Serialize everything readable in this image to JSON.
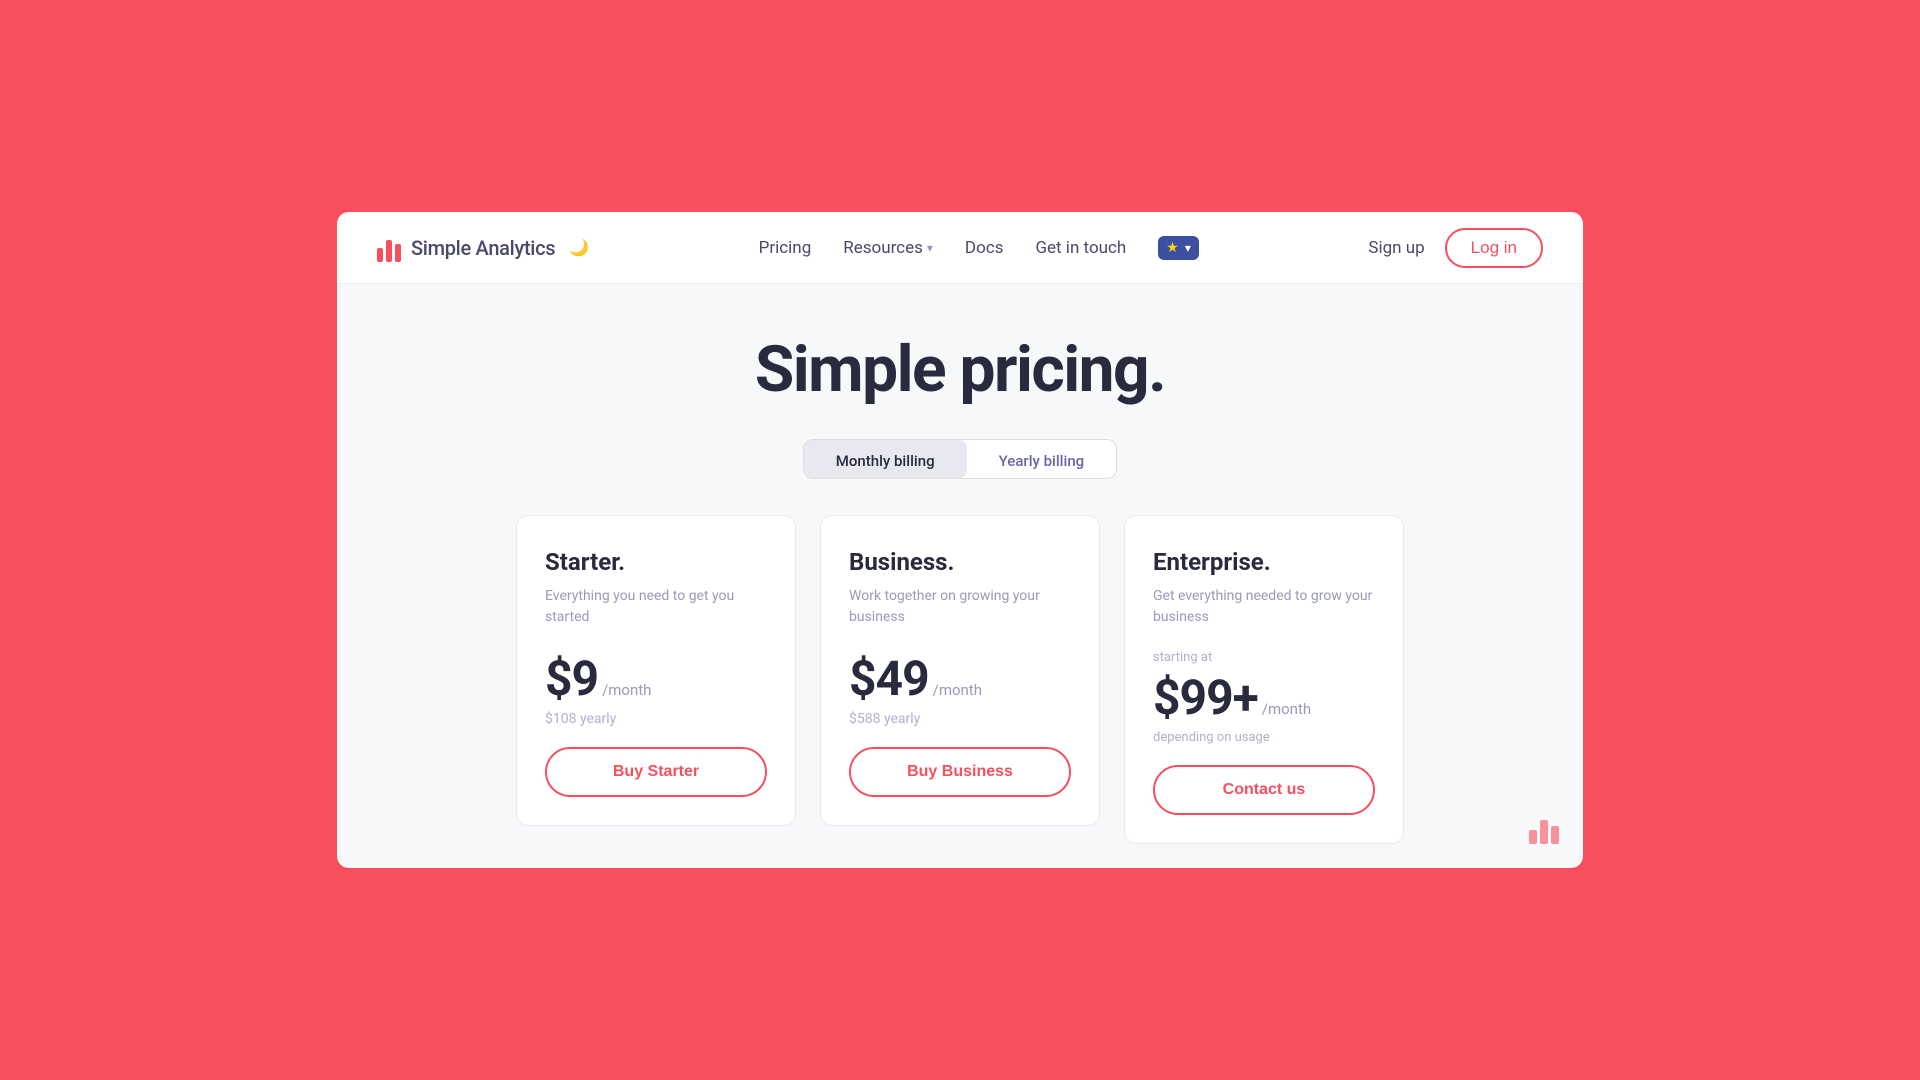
{
  "brand": {
    "name": "Simple Analytics",
    "logo_alt": "Simple Analytics logo"
  },
  "nav": {
    "pricing_label": "Pricing",
    "resources_label": "Resources",
    "docs_label": "Docs",
    "get_in_touch_label": "Get in touch",
    "sign_up_label": "Sign up",
    "log_in_label": "Log in"
  },
  "page": {
    "title": "Simple pricing."
  },
  "billing": {
    "monthly_label": "Monthly billing",
    "yearly_label": "Yearly billing",
    "active": "monthly"
  },
  "plans": [
    {
      "id": "starter",
      "name": "Starter.",
      "description": "Everything you need to get you started",
      "starting_at": "",
      "price": "$9",
      "period": "/month",
      "yearly": "$108 yearly",
      "depending": "",
      "btn_label": "Buy Starter"
    },
    {
      "id": "business",
      "name": "Business.",
      "description": "Work together on growing your business",
      "starting_at": "",
      "price": "$49",
      "period": "/month",
      "yearly": "$588 yearly",
      "depending": "",
      "btn_label": "Buy Business"
    },
    {
      "id": "enterprise",
      "name": "Enterprise.",
      "description": "Get everything needed to grow your business",
      "starting_at": "starting at",
      "price": "$99+",
      "period": "/month",
      "yearly": "",
      "depending": "depending on usage",
      "btn_label": "Contact us"
    }
  ]
}
